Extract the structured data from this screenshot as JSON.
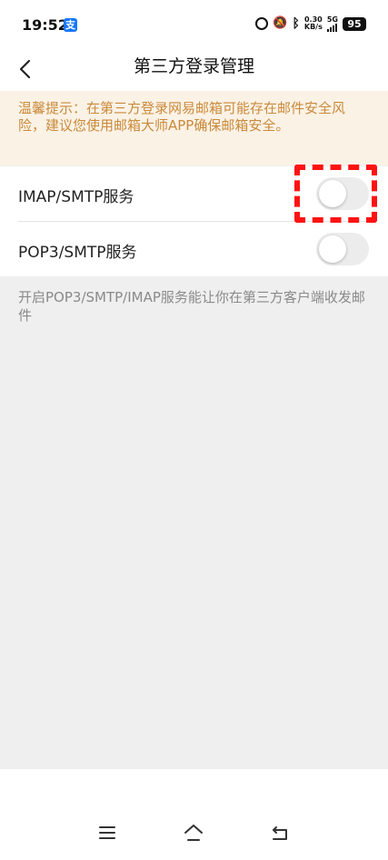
{
  "status_bar": {
    "time": "19:52",
    "alipay_badge": "支",
    "net_speed_value": "0.30",
    "net_speed_unit": "KB/s",
    "network_type": "5G",
    "battery": "95"
  },
  "header": {
    "title": "第三方登录管理",
    "back_icon": "chevron-left-icon"
  },
  "notice": {
    "text": "温馨提示：在第三方登录网易邮箱可能存在邮件安全风险，建议您使用邮箱大师APP确保邮箱安全。"
  },
  "settings": [
    {
      "label": "IMAP/SMTP服务",
      "enabled": false
    },
    {
      "label": "POP3/SMTP服务",
      "enabled": false
    }
  ],
  "info": {
    "text": "开启POP3/SMTP/IMAP服务能让你在第三方客户端收发邮件"
  },
  "colors": {
    "notice_bg": "#fbf2e6",
    "notice_text": "#c98a3a",
    "highlight": "#ff1212",
    "background": "#efefef"
  },
  "system_nav": {
    "menu_icon": "menu-icon",
    "home_icon": "home-icon",
    "back_icon": "back-icon"
  }
}
